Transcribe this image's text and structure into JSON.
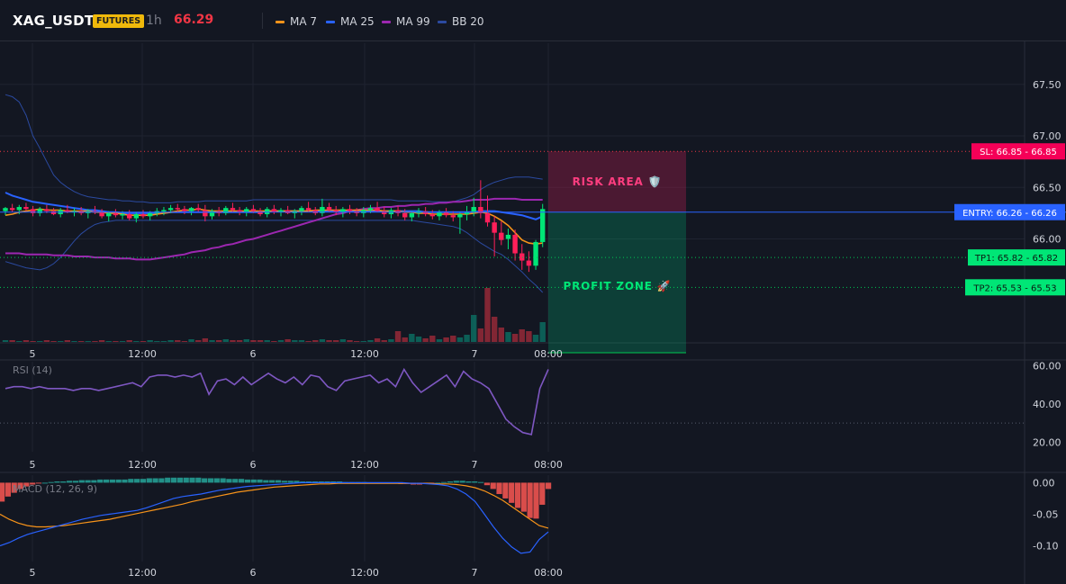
{
  "header": {
    "symbol": "XAG_USDT",
    "badge": "FUTURES",
    "timeframe": "1h",
    "price": "66.29",
    "legend": [
      {
        "label": "MA 7",
        "color": "#f7931a"
      },
      {
        "label": "MA 25",
        "color": "#2962ff"
      },
      {
        "label": "MA 99",
        "color": "#9c27b0"
      },
      {
        "label": "BB 20",
        "color": "#2b4aa0"
      }
    ]
  },
  "colors": {
    "up": "#089981",
    "down": "#f23645",
    "up_bright": "#00e676",
    "down_bright": "#ff1f5a",
    "ma7": "#f7931a",
    "ma25": "#2962ff",
    "ma99": "#9c27b0",
    "bb": "#2b4aa0",
    "rsi": "#7e57c2",
    "macd": "#2962ff",
    "signal": "#f7931a",
    "sl": "#f23645",
    "entry": "#2962ff",
    "tp": "#00c853"
  },
  "chart_data": {
    "type": "candlestick",
    "price_axis": {
      "ticks": [
        "67.50",
        "67.00",
        "66.50",
        "66.00"
      ],
      "min": 65.0,
      "max": 67.9
    },
    "time_axis": {
      "ticks": [
        "5",
        "12:00",
        "6",
        "12:00",
        "7",
        "08:00"
      ]
    },
    "candles": [
      [
        66.27,
        66.31,
        66.23,
        66.3
      ],
      [
        66.3,
        66.34,
        66.26,
        66.28
      ],
      [
        66.28,
        66.33,
        66.24,
        66.31
      ],
      [
        66.31,
        66.35,
        66.27,
        66.29
      ],
      [
        66.29,
        66.32,
        66.22,
        66.25
      ],
      [
        66.25,
        66.31,
        66.22,
        66.29
      ],
      [
        66.29,
        66.33,
        66.25,
        66.27
      ],
      [
        66.27,
        66.3,
        66.23,
        66.24
      ],
      [
        66.24,
        66.3,
        66.21,
        66.28
      ],
      [
        66.28,
        66.33,
        66.25,
        66.26
      ],
      [
        66.26,
        66.3,
        66.22,
        66.27
      ],
      [
        66.27,
        66.31,
        66.23,
        66.25
      ],
      [
        66.25,
        66.29,
        66.2,
        66.27
      ],
      [
        66.27,
        66.32,
        66.24,
        66.26
      ],
      [
        66.26,
        66.29,
        66.2,
        66.22
      ],
      [
        66.22,
        66.27,
        66.17,
        66.25
      ],
      [
        66.25,
        66.29,
        66.21,
        66.23
      ],
      [
        66.23,
        66.27,
        66.19,
        66.24
      ],
      [
        66.24,
        66.28,
        66.18,
        66.2
      ],
      [
        66.2,
        66.26,
        66.16,
        66.24
      ],
      [
        66.24,
        66.28,
        66.2,
        66.22
      ],
      [
        66.22,
        66.27,
        66.18,
        66.25
      ],
      [
        66.25,
        66.3,
        66.22,
        66.27
      ],
      [
        66.27,
        66.31,
        66.23,
        66.28
      ],
      [
        66.28,
        66.33,
        66.25,
        66.3
      ],
      [
        66.3,
        66.34,
        66.26,
        66.29
      ],
      [
        66.29,
        66.32,
        66.24,
        66.27
      ],
      [
        66.27,
        66.31,
        66.23,
        66.3
      ],
      [
        66.3,
        66.34,
        66.26,
        66.28
      ],
      [
        66.28,
        66.33,
        66.17,
        66.22
      ],
      [
        66.22,
        66.29,
        66.19,
        66.27
      ],
      [
        66.27,
        66.31,
        66.22,
        66.25
      ],
      [
        66.25,
        66.32,
        66.23,
        66.3
      ],
      [
        66.3,
        66.35,
        66.26,
        66.28
      ],
      [
        66.28,
        66.31,
        66.23,
        66.26
      ],
      [
        66.26,
        66.31,
        66.22,
        66.29
      ],
      [
        66.29,
        66.33,
        66.25,
        66.27
      ],
      [
        66.27,
        66.3,
        66.22,
        66.24
      ],
      [
        66.24,
        66.31,
        66.21,
        66.29
      ],
      [
        66.29,
        66.33,
        66.24,
        66.26
      ],
      [
        66.26,
        66.3,
        66.22,
        66.28
      ],
      [
        66.28,
        66.32,
        66.24,
        66.25
      ],
      [
        66.25,
        66.29,
        66.2,
        66.27
      ],
      [
        66.27,
        66.32,
        66.23,
        66.3
      ],
      [
        66.3,
        66.36,
        66.26,
        66.28
      ],
      [
        66.28,
        66.31,
        66.23,
        66.25
      ],
      [
        66.25,
        66.39,
        66.22,
        66.31
      ],
      [
        66.31,
        66.35,
        66.26,
        66.28
      ],
      [
        66.28,
        66.32,
        66.23,
        66.26
      ],
      [
        66.26,
        66.31,
        66.21,
        66.29
      ],
      [
        66.29,
        66.33,
        66.24,
        66.27
      ],
      [
        66.27,
        66.3,
        66.22,
        66.25
      ],
      [
        66.25,
        66.31,
        66.21,
        66.28
      ],
      [
        66.28,
        66.33,
        66.25,
        66.3
      ],
      [
        66.3,
        66.36,
        66.26,
        66.27
      ],
      [
        66.27,
        66.31,
        66.21,
        66.24
      ],
      [
        66.24,
        66.3,
        66.2,
        66.28
      ],
      [
        66.28,
        66.32,
        66.22,
        66.25
      ],
      [
        66.25,
        66.29,
        66.18,
        66.21
      ],
      [
        66.21,
        66.27,
        66.17,
        66.25
      ],
      [
        66.25,
        66.3,
        66.21,
        66.27
      ],
      [
        66.27,
        66.31,
        66.22,
        66.24
      ],
      [
        66.24,
        66.28,
        66.19,
        66.22
      ],
      [
        66.22,
        66.28,
        66.18,
        66.26
      ],
      [
        66.26,
        66.3,
        66.21,
        66.23
      ],
      [
        66.23,
        66.27,
        66.17,
        66.21
      ],
      [
        66.21,
        66.26,
        66.05,
        66.24
      ],
      [
        66.24,
        66.32,
        66.18,
        66.26
      ],
      [
        66.26,
        66.4,
        66.22,
        66.31
      ],
      [
        66.31,
        66.57,
        66.2,
        66.25
      ],
      [
        66.25,
        66.42,
        66.12,
        66.16
      ],
      [
        66.16,
        66.22,
        65.83,
        66.06
      ],
      [
        66.06,
        66.17,
        65.94,
        65.99
      ],
      [
        66.0,
        66.1,
        65.9,
        66.04
      ],
      [
        66.04,
        66.09,
        65.79,
        65.86
      ],
      [
        65.86,
        65.95,
        65.7,
        65.79
      ],
      [
        65.79,
        65.88,
        65.68,
        65.74
      ],
      [
        65.74,
        65.99,
        65.7,
        65.97
      ],
      [
        65.97,
        66.34,
        65.92,
        66.29
      ]
    ],
    "volume": [
      2,
      2,
      1,
      2,
      1,
      1,
      2,
      1,
      1,
      2,
      1,
      1,
      1,
      1,
      2,
      1,
      1,
      1,
      2,
      1,
      1,
      2,
      1,
      1,
      2,
      2,
      1,
      3,
      2,
      4,
      2,
      2,
      3,
      2,
      2,
      3,
      2,
      2,
      2,
      1,
      2,
      3,
      2,
      2,
      1,
      2,
      3,
      2,
      2,
      3,
      2,
      1,
      1,
      2,
      4,
      2,
      3,
      12,
      5,
      9,
      6,
      4,
      7,
      3,
      5,
      7,
      5,
      8,
      30,
      15,
      60,
      28,
      16,
      11,
      9,
      14,
      12,
      8,
      22
    ],
    "ma7": [
      66.23,
      66.24,
      66.26,
      66.27,
      66.28,
      66.29,
      66.28,
      66.28,
      66.28,
      66.27,
      66.27,
      66.27,
      66.27,
      66.26,
      66.26,
      66.25,
      66.25,
      66.24,
      66.23,
      66.23,
      66.23,
      66.23,
      66.24,
      66.25,
      66.26,
      66.27,
      66.28,
      66.28,
      66.29,
      66.28,
      66.27,
      66.27,
      66.27,
      66.27,
      66.27,
      66.27,
      66.27,
      66.27,
      66.27,
      66.27,
      66.27,
      66.27,
      66.27,
      66.27,
      66.27,
      66.28,
      66.28,
      66.28,
      66.28,
      66.28,
      66.28,
      66.28,
      66.28,
      66.28,
      66.28,
      66.27,
      66.27,
      66.27,
      66.26,
      66.26,
      66.25,
      66.25,
      66.24,
      66.24,
      66.24,
      66.24,
      66.24,
      66.24,
      66.25,
      66.26,
      66.25,
      66.22,
      66.18,
      66.13,
      66.06,
      65.99,
      65.96,
      65.95,
      65.96
    ],
    "ma25": [
      66.45,
      66.42,
      66.4,
      66.38,
      66.36,
      66.35,
      66.34,
      66.33,
      66.32,
      66.31,
      66.3,
      66.29,
      66.28,
      66.28,
      66.27,
      66.26,
      66.26,
      66.25,
      66.25,
      66.25,
      66.25,
      66.25,
      66.25,
      66.25,
      66.26,
      66.26,
      66.26,
      66.26,
      66.26,
      66.26,
      66.26,
      66.26,
      66.26,
      66.26,
      66.26,
      66.26,
      66.26,
      66.26,
      66.27,
      66.27,
      66.27,
      66.27,
      66.27,
      66.27,
      66.27,
      66.27,
      66.27,
      66.27,
      66.27,
      66.27,
      66.27,
      66.27,
      66.27,
      66.27,
      66.27,
      66.27,
      66.27,
      66.27,
      66.27,
      66.27,
      66.27,
      66.26,
      66.26,
      66.26,
      66.26,
      66.26,
      66.26,
      66.26,
      66.26,
      66.27,
      66.27,
      66.27,
      66.26,
      66.25,
      66.24,
      66.23,
      66.21,
      66.19,
      66.22
    ],
    "ma99": [
      65.86,
      65.86,
      65.86,
      65.85,
      65.85,
      65.85,
      65.85,
      65.84,
      65.84,
      65.84,
      65.83,
      65.83,
      65.83,
      65.82,
      65.82,
      65.82,
      65.81,
      65.81,
      65.81,
      65.8,
      65.8,
      65.8,
      65.81,
      65.82,
      65.83,
      65.84,
      65.85,
      65.87,
      65.88,
      65.89,
      65.91,
      65.92,
      65.94,
      65.95,
      65.97,
      65.99,
      66.0,
      66.02,
      66.04,
      66.06,
      66.08,
      66.1,
      66.12,
      66.14,
      66.16,
      66.18,
      66.2,
      66.22,
      66.24,
      66.25,
      66.27,
      66.28,
      66.29,
      66.3,
      66.3,
      66.31,
      66.31,
      66.32,
      66.32,
      66.33,
      66.33,
      66.34,
      66.34,
      66.35,
      66.35,
      66.36,
      66.36,
      66.37,
      66.38,
      66.38,
      66.38,
      66.39,
      66.39,
      66.39,
      66.39,
      66.38,
      66.38,
      66.38,
      66.38
    ],
    "bb_upper": [
      67.4,
      67.38,
      67.33,
      67.2,
      67.0,
      66.88,
      66.75,
      66.62,
      66.55,
      66.5,
      66.46,
      66.43,
      66.41,
      66.4,
      66.39,
      66.38,
      66.38,
      66.37,
      66.37,
      66.36,
      66.36,
      66.35,
      66.35,
      66.35,
      66.35,
      66.36,
      66.36,
      66.36,
      66.36,
      66.37,
      66.37,
      66.37,
      66.37,
      66.37,
      66.37,
      66.37,
      66.38,
      66.38,
      66.38,
      66.38,
      66.38,
      66.38,
      66.38,
      66.38,
      66.38,
      66.38,
      66.38,
      66.38,
      66.38,
      66.38,
      66.38,
      66.38,
      66.38,
      66.38,
      66.38,
      66.38,
      66.38,
      66.37,
      66.37,
      66.37,
      66.37,
      66.37,
      66.36,
      66.36,
      66.36,
      66.36,
      66.38,
      66.4,
      66.43,
      66.48,
      66.52,
      66.55,
      66.57,
      66.59,
      66.6,
      66.6,
      66.6,
      66.59,
      66.58
    ],
    "bb_lower": [
      65.78,
      65.76,
      65.74,
      65.72,
      65.71,
      65.7,
      65.72,
      65.76,
      65.82,
      65.9,
      65.98,
      66.05,
      66.1,
      66.14,
      66.16,
      66.17,
      66.18,
      66.18,
      66.18,
      66.18,
      66.18,
      66.18,
      66.18,
      66.18,
      66.18,
      66.18,
      66.18,
      66.18,
      66.18,
      66.18,
      66.18,
      66.18,
      66.18,
      66.18,
      66.18,
      66.18,
      66.18,
      66.18,
      66.18,
      66.18,
      66.18,
      66.18,
      66.18,
      66.18,
      66.18,
      66.18,
      66.18,
      66.18,
      66.18,
      66.18,
      66.18,
      66.18,
      66.18,
      66.18,
      66.18,
      66.18,
      66.18,
      66.18,
      66.18,
      66.18,
      66.17,
      66.16,
      66.15,
      66.14,
      66.13,
      66.12,
      66.1,
      66.06,
      66.01,
      65.96,
      65.92,
      65.88,
      65.85,
      65.8,
      65.74,
      65.68,
      65.61,
      65.55,
      65.48
    ],
    "trade": {
      "sl": 66.85,
      "entry": 66.26,
      "tp1": 65.82,
      "tp2": 65.53
    },
    "trade_labels": {
      "sl": "SL: 66.85 - 66.85",
      "entry": "ENTRY: 66.26 - 66.26",
      "tp1": "TP1: 65.82 - 65.82",
      "tp2": "TP2: 65.53 - 65.53",
      "risk": "RISK AREA 🛡️",
      "profit": "PROFIT ZONE 🚀"
    },
    "rsi": {
      "label": "RSI (14)",
      "ticks": [
        "60.00",
        "40.00",
        "20.00"
      ],
      "min": 15,
      "max": 62,
      "values": [
        48,
        49,
        49,
        48,
        49,
        48,
        48,
        48,
        47,
        48,
        48,
        47,
        48,
        49,
        50,
        51,
        49,
        54,
        55,
        55,
        54,
        55,
        54,
        56,
        45,
        52,
        53,
        50,
        54,
        50,
        53,
        56,
        53,
        51,
        54,
        50,
        55,
        54,
        49,
        47,
        52,
        53,
        54,
        55,
        51,
        53,
        49,
        58,
        51,
        46,
        49,
        52,
        55,
        49,
        57,
        53,
        51,
        48,
        40,
        32,
        28,
        25,
        24,
        48,
        58
      ]
    },
    "macd": {
      "label": "MACD (12, 26, 9)",
      "ticks": [
        "0.00",
        "-0.05",
        "-0.10"
      ],
      "min": -0.125,
      "max": 0.012,
      "hist": [
        -0.03,
        -0.022,
        -0.016,
        -0.01,
        -0.006,
        -0.003,
        -0.001,
        0.0,
        0.001,
        0.002,
        0.002,
        0.003,
        0.003,
        0.004,
        0.004,
        0.004,
        0.005,
        0.005,
        0.005,
        0.005,
        0.005,
        0.006,
        0.006,
        0.006,
        0.007,
        0.007,
        0.007,
        0.008,
        0.008,
        0.008,
        0.008,
        0.008,
        0.008,
        0.007,
        0.007,
        0.007,
        0.007,
        0.006,
        0.006,
        0.006,
        0.005,
        0.005,
        0.005,
        0.004,
        0.004,
        0.004,
        0.003,
        0.003,
        0.003,
        0.002,
        0.002,
        0.002,
        0.002,
        0.002,
        0.002,
        0.002,
        0.001,
        0.001,
        0.001,
        0.001,
        0.0,
        0.0,
        0.0,
        -0.001,
        -0.001,
        -0.002,
        -0.002,
        -0.003,
        -0.003,
        -0.002,
        -0.001,
        0.0,
        0.001,
        0.002,
        0.003,
        0.003,
        0.002,
        0.002,
        0.001,
        -0.004,
        -0.01,
        -0.018,
        -0.025,
        -0.032,
        -0.04,
        -0.046,
        -0.056,
        -0.057,
        -0.035,
        -0.01
      ],
      "macd": [
        -0.1,
        -0.095,
        -0.088,
        -0.082,
        -0.078,
        -0.074,
        -0.07,
        -0.066,
        -0.062,
        -0.058,
        -0.055,
        -0.052,
        -0.05,
        -0.048,
        -0.046,
        -0.044,
        -0.04,
        -0.035,
        -0.03,
        -0.025,
        -0.022,
        -0.02,
        -0.018,
        -0.015,
        -0.012,
        -0.01,
        -0.008,
        -0.006,
        -0.005,
        -0.004,
        -0.003,
        -0.002,
        -0.001,
        0.0,
        0.0,
        0.0,
        0.0,
        0.0,
        0.0,
        0.0,
        0.0,
        0.0,
        0.0,
        0.0,
        0.0,
        -0.001,
        -0.001,
        -0.002,
        -0.003,
        -0.005,
        -0.01,
        -0.018,
        -0.03,
        -0.05,
        -0.07,
        -0.088,
        -0.102,
        -0.112,
        -0.11,
        -0.09,
        -0.078
      ],
      "signal": [
        -0.05,
        -0.058,
        -0.064,
        -0.068,
        -0.07,
        -0.07,
        -0.069,
        -0.068,
        -0.066,
        -0.064,
        -0.062,
        -0.06,
        -0.058,
        -0.055,
        -0.052,
        -0.049,
        -0.046,
        -0.043,
        -0.04,
        -0.037,
        -0.034,
        -0.03,
        -0.027,
        -0.024,
        -0.021,
        -0.018,
        -0.015,
        -0.013,
        -0.011,
        -0.009,
        -0.007,
        -0.006,
        -0.005,
        -0.004,
        -0.003,
        -0.002,
        -0.002,
        -0.001,
        -0.001,
        -0.001,
        -0.001,
        -0.001,
        -0.001,
        -0.001,
        -0.001,
        -0.001,
        -0.001,
        -0.001,
        -0.002,
        -0.002,
        -0.003,
        -0.005,
        -0.008,
        -0.013,
        -0.02,
        -0.028,
        -0.038,
        -0.048,
        -0.058,
        -0.068,
        -0.072
      ]
    }
  }
}
